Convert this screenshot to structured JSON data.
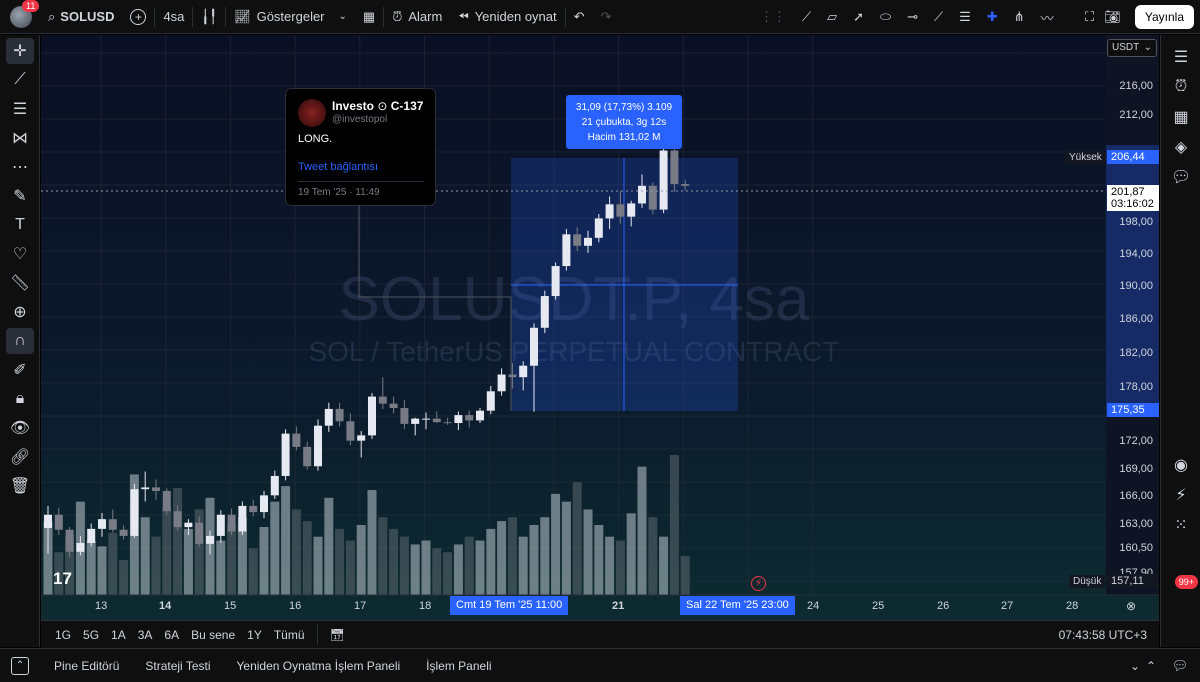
{
  "topbar": {
    "notif_count": "11",
    "symbol": "SOLUSD",
    "interval": "4sa",
    "indicators_label": "Göstergeler",
    "alarm_label": "Alarm",
    "replay_label": "Yeniden oynat",
    "publish_label": "Yayınla"
  },
  "watermark": {
    "title": "SOLUSDT.P, 4sa",
    "subtitle": "SOL / TetherUS PERPETUAL CONTRACT"
  },
  "price_axis": {
    "currency": "USDT",
    "labels": [
      "216,00",
      "212,00",
      "198,00",
      "194,00",
      "190,00",
      "186,00",
      "182,00",
      "178,00",
      "172,00",
      "169,00",
      "166,00",
      "163,00",
      "160,50",
      "157,90"
    ],
    "high_label": "Yüksek",
    "high_value": "206,44",
    "current_price": "201,87",
    "countdown": "03:16:02",
    "range_low": "175,35",
    "low_label": "Düşük",
    "low_value": "157,11"
  },
  "time_axis": {
    "labels": [
      "13",
      "14",
      "15",
      "16",
      "17",
      "18",
      "21",
      "24",
      "25",
      "26",
      "27",
      "28"
    ],
    "start_tag": "Cmt 19 Tem '25   11:00",
    "end_tag": "Sal 22 Tem '25   23:00"
  },
  "tweet": {
    "author": "Investo",
    "author_suffix": "C-137",
    "handle": "@investopol",
    "text": "LONG.",
    "link": "Tweet bağlantısı",
    "date": "19 Tem '25 · 11:49"
  },
  "measure": {
    "line1": "31,09 (17,73%) 3.109",
    "line2": "21 çubukta, 3g 12s",
    "line3": "Hacim 131,02 M"
  },
  "bottombar": {
    "ranges": [
      "1G",
      "5G",
      "1A",
      "3A",
      "6A",
      "Bu sene",
      "1Y",
      "Tümü"
    ],
    "clock": "07:43:58 UTC+3"
  },
  "footer": {
    "tabs": [
      "Pine Editörü",
      "Strateji Testi",
      "Yeniden Oynatma İşlem Paneli",
      "İşlem Paneli"
    ]
  },
  "right_badge": "99+",
  "logo": "17",
  "colors": {
    "up": "#e6e9f2",
    "down": "#787b86",
    "accent": "#2962ff",
    "range_box": "rgba(41,98,255,0.22)"
  },
  "chart_data": {
    "type": "candlestick",
    "ohlc": [
      [
        163.1,
        165.6,
        160.2,
        164.6
      ],
      [
        164.6,
        165.4,
        162.3,
        162.9
      ],
      [
        162.9,
        163.2,
        159.8,
        160.4
      ],
      [
        160.4,
        162.2,
        160.0,
        161.4
      ],
      [
        161.4,
        163.6,
        161.0,
        163.0
      ],
      [
        163.0,
        164.8,
        162.1,
        164.1
      ],
      [
        164.1,
        165.2,
        162.6,
        162.9
      ],
      [
        162.9,
        163.4,
        161.8,
        162.2
      ],
      [
        162.2,
        168.1,
        162.0,
        167.5
      ],
      [
        167.5,
        169.5,
        166.1,
        167.7
      ],
      [
        167.7,
        168.6,
        166.3,
        167.3
      ],
      [
        167.3,
        167.6,
        164.6,
        165.0
      ],
      [
        165.0,
        165.6,
        162.8,
        163.2
      ],
      [
        163.2,
        164.1,
        162.3,
        163.7
      ],
      [
        163.7,
        164.4,
        161.0,
        161.3
      ],
      [
        161.3,
        162.8,
        160.1,
        162.2
      ],
      [
        162.2,
        165.1,
        161.4,
        164.6
      ],
      [
        164.6,
        165.3,
        162.3,
        162.7
      ],
      [
        162.7,
        166.1,
        162.3,
        165.6
      ],
      [
        165.6,
        166.3,
        164.4,
        164.9
      ],
      [
        164.9,
        167.3,
        164.2,
        166.8
      ],
      [
        166.8,
        169.6,
        166.4,
        169.0
      ],
      [
        169.0,
        174.3,
        168.5,
        173.8
      ],
      [
        173.8,
        174.6,
        171.9,
        172.3
      ],
      [
        172.3,
        172.9,
        169.7,
        170.1
      ],
      [
        170.1,
        175.4,
        169.6,
        174.7
      ],
      [
        174.7,
        177.3,
        174.0,
        176.6
      ],
      [
        176.6,
        177.3,
        174.6,
        175.2
      ],
      [
        175.2,
        176.1,
        172.5,
        173.0
      ],
      [
        173.0,
        174.1,
        171.1,
        173.6
      ],
      [
        173.6,
        178.4,
        173.2,
        178.0
      ],
      [
        178.0,
        180.2,
        176.6,
        177.2
      ],
      [
        177.2,
        178.0,
        176.1,
        176.7
      ],
      [
        176.7,
        177.6,
        174.3,
        174.9
      ],
      [
        174.9,
        175.6,
        173.6,
        175.5
      ],
      [
        175.5,
        176.2,
        174.3,
        175.5
      ],
      [
        175.5,
        176.3,
        175.0,
        175.1
      ],
      [
        175.1,
        175.6,
        174.8,
        175.0
      ],
      [
        175.0,
        176.3,
        174.2,
        175.9
      ],
      [
        175.9,
        176.4,
        174.5,
        175.3
      ],
      [
        175.3,
        176.7,
        175.0,
        176.4
      ],
      [
        176.4,
        179.2,
        176.0,
        178.6
      ],
      [
        178.6,
        181.2,
        178.1,
        180.5
      ],
      [
        180.5,
        181.8,
        178.9,
        180.2
      ],
      [
        180.2,
        182.0,
        178.7,
        181.5
      ],
      [
        181.5,
        186.3,
        176.3,
        185.8
      ],
      [
        185.8,
        190.0,
        185.2,
        189.4
      ],
      [
        189.4,
        193.2,
        189.0,
        192.8
      ],
      [
        192.8,
        197.0,
        192.3,
        196.4
      ],
      [
        196.4,
        197.2,
        194.5,
        195.1
      ],
      [
        195.1,
        196.8,
        194.3,
        196.0
      ],
      [
        196.0,
        198.7,
        195.5,
        198.2
      ],
      [
        198.2,
        200.7,
        197.0,
        199.8
      ],
      [
        199.8,
        201.3,
        197.6,
        198.4
      ],
      [
        198.4,
        200.2,
        197.3,
        199.9
      ],
      [
        199.9,
        203.2,
        199.4,
        201.9
      ],
      [
        201.9,
        202.3,
        198.7,
        199.2
      ],
      [
        199.2,
        206.2,
        198.8,
        205.9
      ],
      [
        205.9,
        206.4,
        201.2,
        202.1
      ],
      [
        202.1,
        202.6,
        201.4,
        201.9
      ]
    ],
    "volume": [
      38,
      22,
      30,
      48,
      28,
      25,
      32,
      18,
      62,
      40,
      30,
      45,
      55,
      34,
      44,
      50,
      28,
      36,
      40,
      24,
      35,
      48,
      56,
      44,
      38,
      30,
      50,
      34,
      28,
      36,
      54,
      40,
      34,
      30,
      26,
      28,
      24,
      22,
      26,
      30,
      28,
      34,
      38,
      40,
      30,
      36,
      40,
      52,
      48,
      58,
      44,
      36,
      30,
      28,
      42,
      66,
      40,
      30,
      72,
      20
    ],
    "ylim": [
      155.5,
      219.0
    ],
    "xlabel": "",
    "ylabel": ""
  }
}
